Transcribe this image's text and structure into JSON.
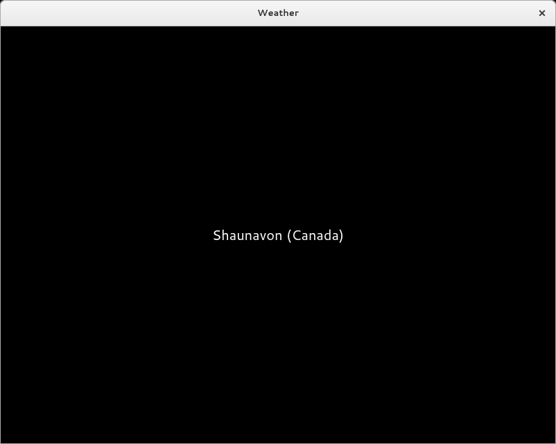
{
  "window": {
    "title": "Weather"
  },
  "content": {
    "location_label": "Shaunavon (Canada)"
  }
}
